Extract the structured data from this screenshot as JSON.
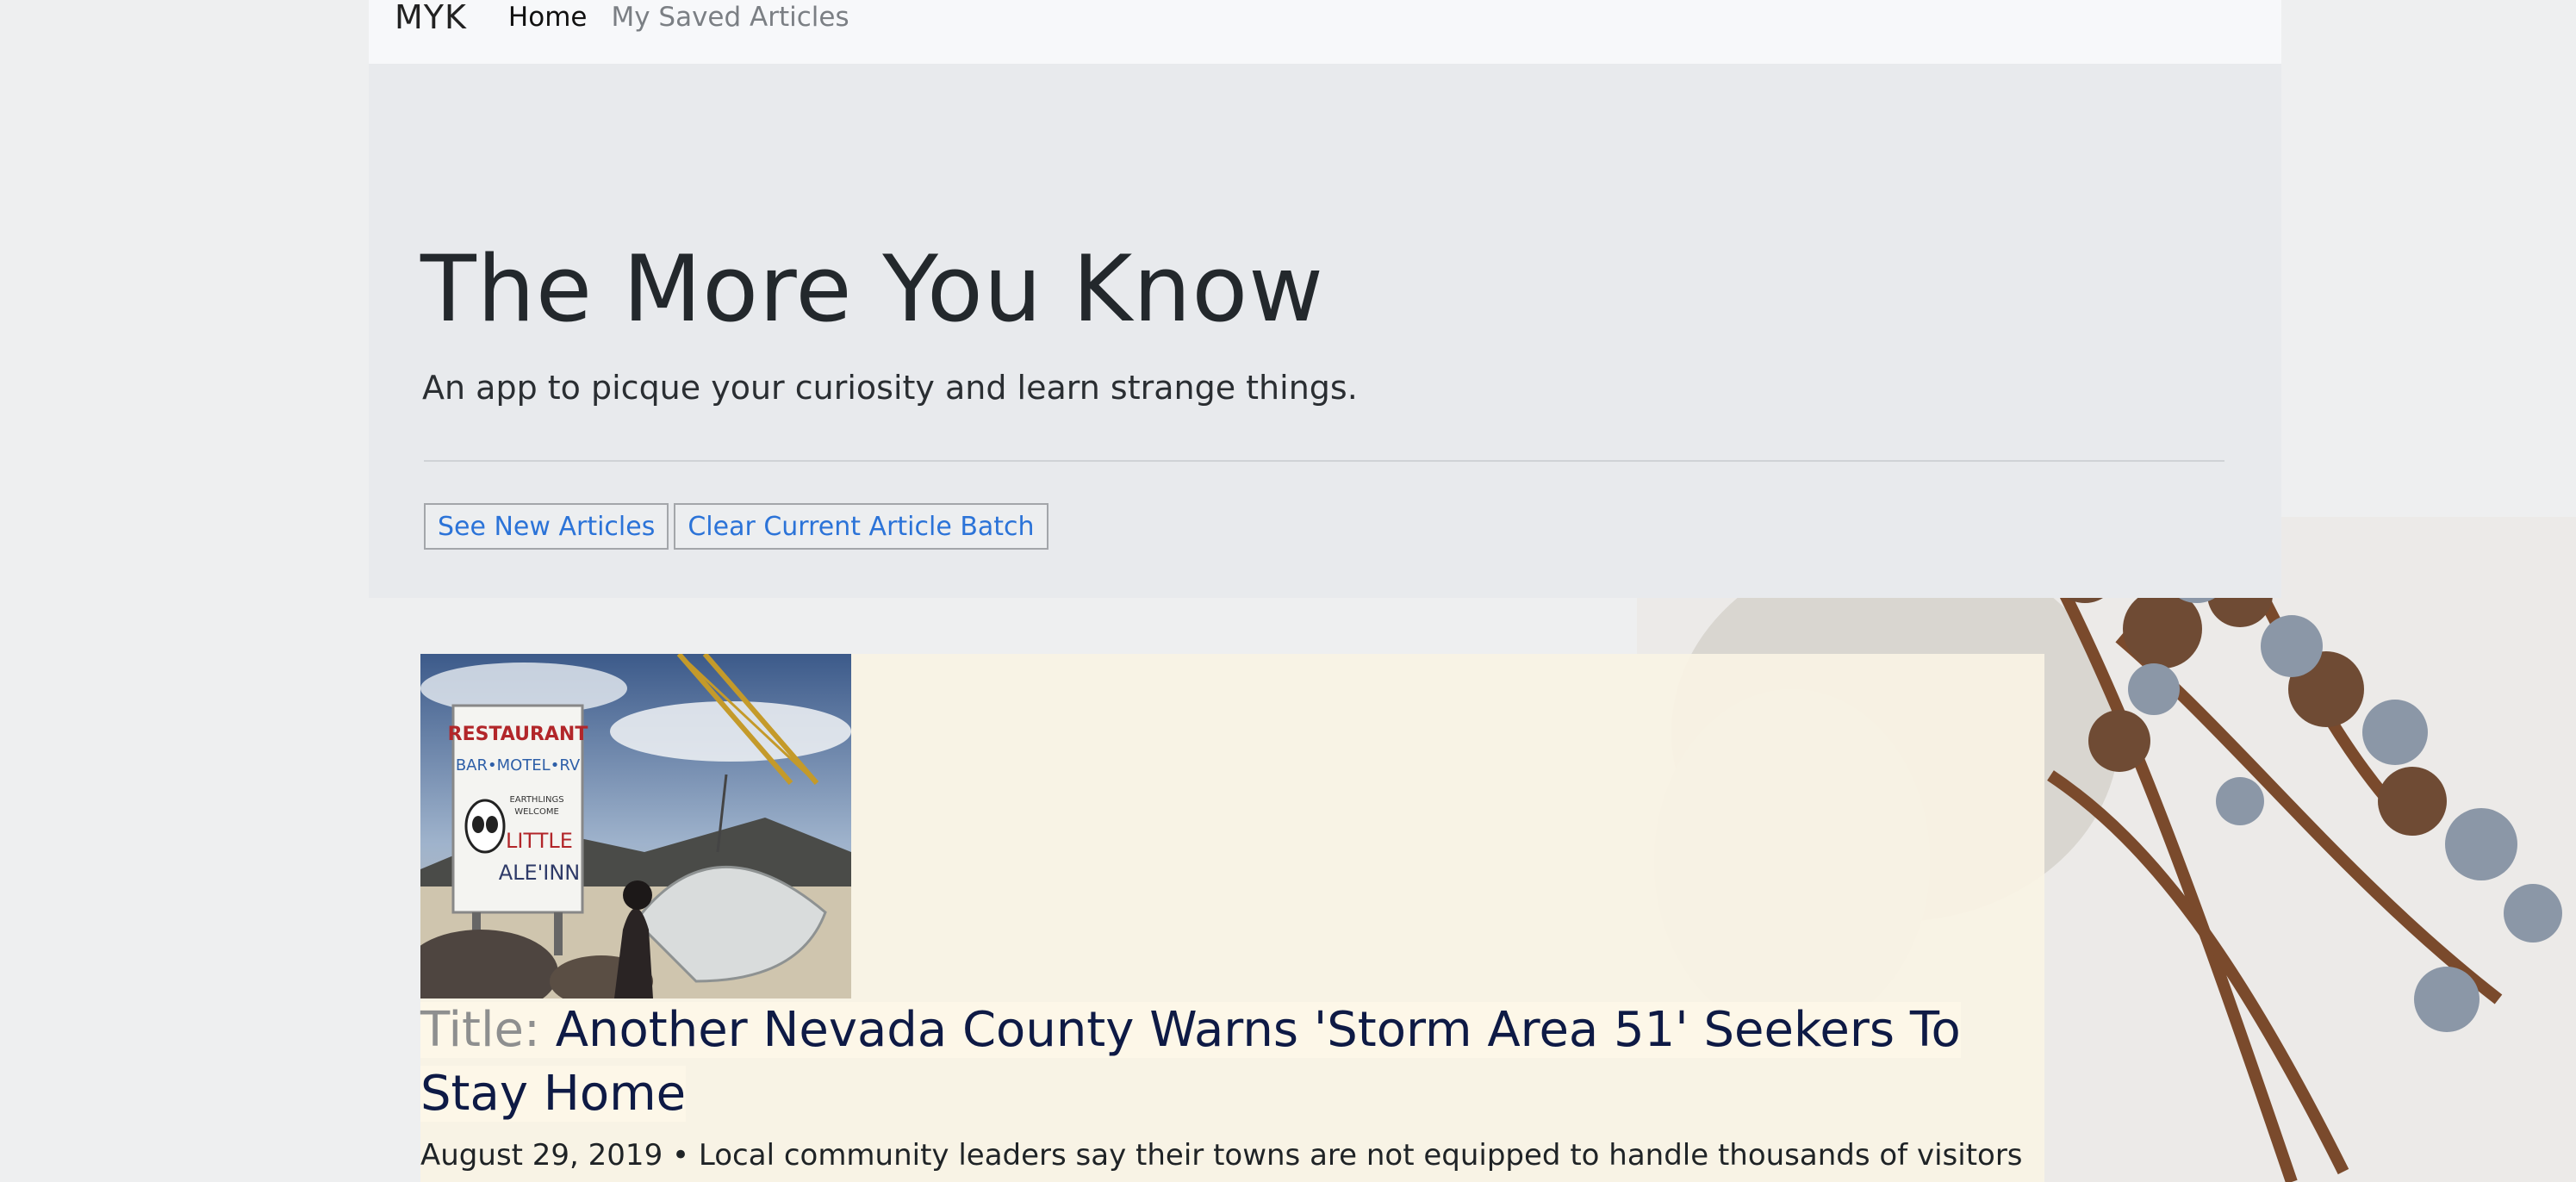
{
  "navbar": {
    "brand": "MYK",
    "links": [
      {
        "label": "Home",
        "active": true
      },
      {
        "label": "My Saved Articles",
        "active": false
      }
    ]
  },
  "hero": {
    "title": "The More You Know",
    "subtitle": "An app to picque your curiosity and learn strange things.",
    "buttons": {
      "new_articles": "See New Articles",
      "clear_batch": "Clear Current Article Batch"
    }
  },
  "article": {
    "title_label": "Title:",
    "title": "Another Nevada County Warns 'Storm Area 51' Seekers To Stay Home",
    "date": "August 29, 2019",
    "separator": "•",
    "summary": "Local community leaders say their towns are not equipped to handle thousands of visitors",
    "image": {
      "sign_lines": [
        "RESTAURANT",
        "BAR•MOTEL•RV",
        "EARTHLINGS",
        "WELCOME",
        "LITTLE",
        "ALE'INN"
      ]
    }
  },
  "colors": {
    "link_blue": "#2b73d8",
    "title_navy": "#0e1a45",
    "jumbotron_bg": "#e8eaed",
    "navbar_bg": "#f7f8fa"
  }
}
